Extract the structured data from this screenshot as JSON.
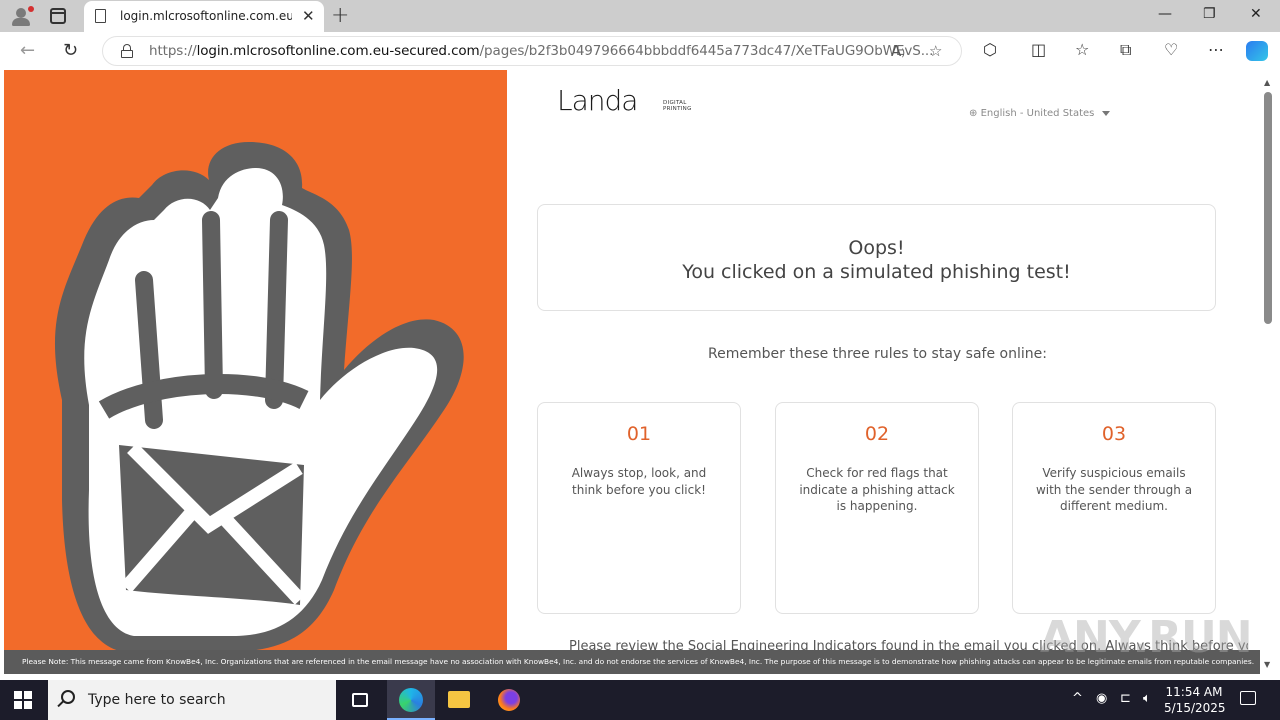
{
  "browser": {
    "tab_title": "login.mlcrosoftonline.com.eu-se",
    "tab_close": "✕",
    "new_tab": "+",
    "url_proto": "https://",
    "url_host": "login.mlcrosoftonline.com.eu-secured.com",
    "url_path": "/pages/b2f3b049796664bbbddf6445a773dc47/XeTFaUG9ObWEvS...",
    "window_controls": {
      "minimize": "—",
      "restore": "❐",
      "close": "✕"
    }
  },
  "page": {
    "logo_text": "Landa",
    "logo_sub": "DIGITAL PRINTING",
    "language": "English - United States",
    "oops_line1": "Oops!",
    "oops_line2": "You clicked on a simulated phishing test!",
    "remember": "Remember these three rules to stay safe online:",
    "rules": [
      {
        "num": "01",
        "text": "Always stop, look, and think before you click!"
      },
      {
        "num": "02",
        "text": "Check for red flags that indicate a phishing attack is happening."
      },
      {
        "num": "03",
        "text": "Verify suspicious emails with the sender through a different medium."
      }
    ],
    "review": "Please review the Social Engineering Indicators found in the email you clicked on. Always think before you click.",
    "note": "Please Note: This message came from KnowBe4, Inc. Organizations that are referenced in the email message have no association with KnowBe4, Inc. and do not endorse the services of KnowBe4, Inc. The purpose of this message is to demonstrate how phishing attacks can appear to be legitimate emails from reputable companies.",
    "watermark": "ANY.RUN"
  },
  "taskbar": {
    "search_placeholder": "Type here to search",
    "time": "11:54 AM",
    "date": "5/15/2025"
  },
  "colors": {
    "brand_orange": "#f26b2a",
    "rule_number": "#e0622b",
    "taskbar": "#1c1c2a"
  }
}
